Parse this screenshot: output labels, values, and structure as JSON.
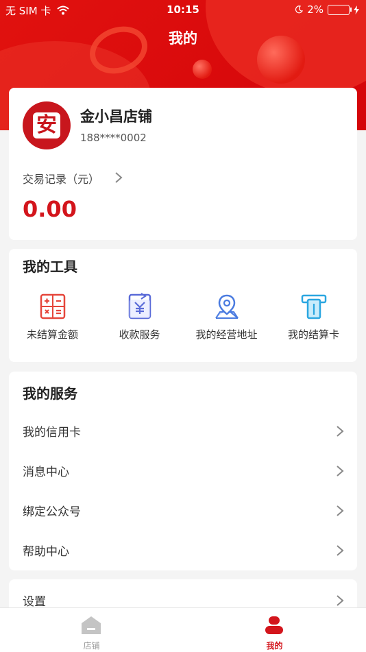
{
  "status_bar": {
    "carrier": "无 SIM 卡",
    "time": "10:15",
    "battery": "2%"
  },
  "page_title": "我的",
  "profile": {
    "avatar_char": "安",
    "shop_name": "金小昌店铺",
    "phone": "188****0002",
    "trade_label": "交易记录（元）",
    "amount": "0.00"
  },
  "tools": {
    "title": "我的工具",
    "items": [
      {
        "label": "未结算金额",
        "icon": "calculator-icon"
      },
      {
        "label": "收款服务",
        "icon": "yuan-document-icon"
      },
      {
        "label": "我的经营地址",
        "icon": "location-pin-icon"
      },
      {
        "label": "我的结算卡",
        "icon": "card-slot-icon"
      }
    ]
  },
  "services": {
    "title": "我的服务",
    "items": [
      {
        "label": "我的信用卡"
      },
      {
        "label": "消息中心"
      },
      {
        "label": "绑定公众号"
      },
      {
        "label": "帮助中心"
      }
    ]
  },
  "settings": {
    "label": "设置"
  },
  "tabbar": {
    "tabs": [
      {
        "label": "店铺",
        "active": false,
        "icon": "shop-icon"
      },
      {
        "label": "我的",
        "active": true,
        "icon": "user-icon"
      }
    ],
    "active_color": "#d3151c",
    "inactive_color": "#999999"
  },
  "colors": {
    "brand_red": "#d3151c",
    "header_red": "#e1120f"
  }
}
